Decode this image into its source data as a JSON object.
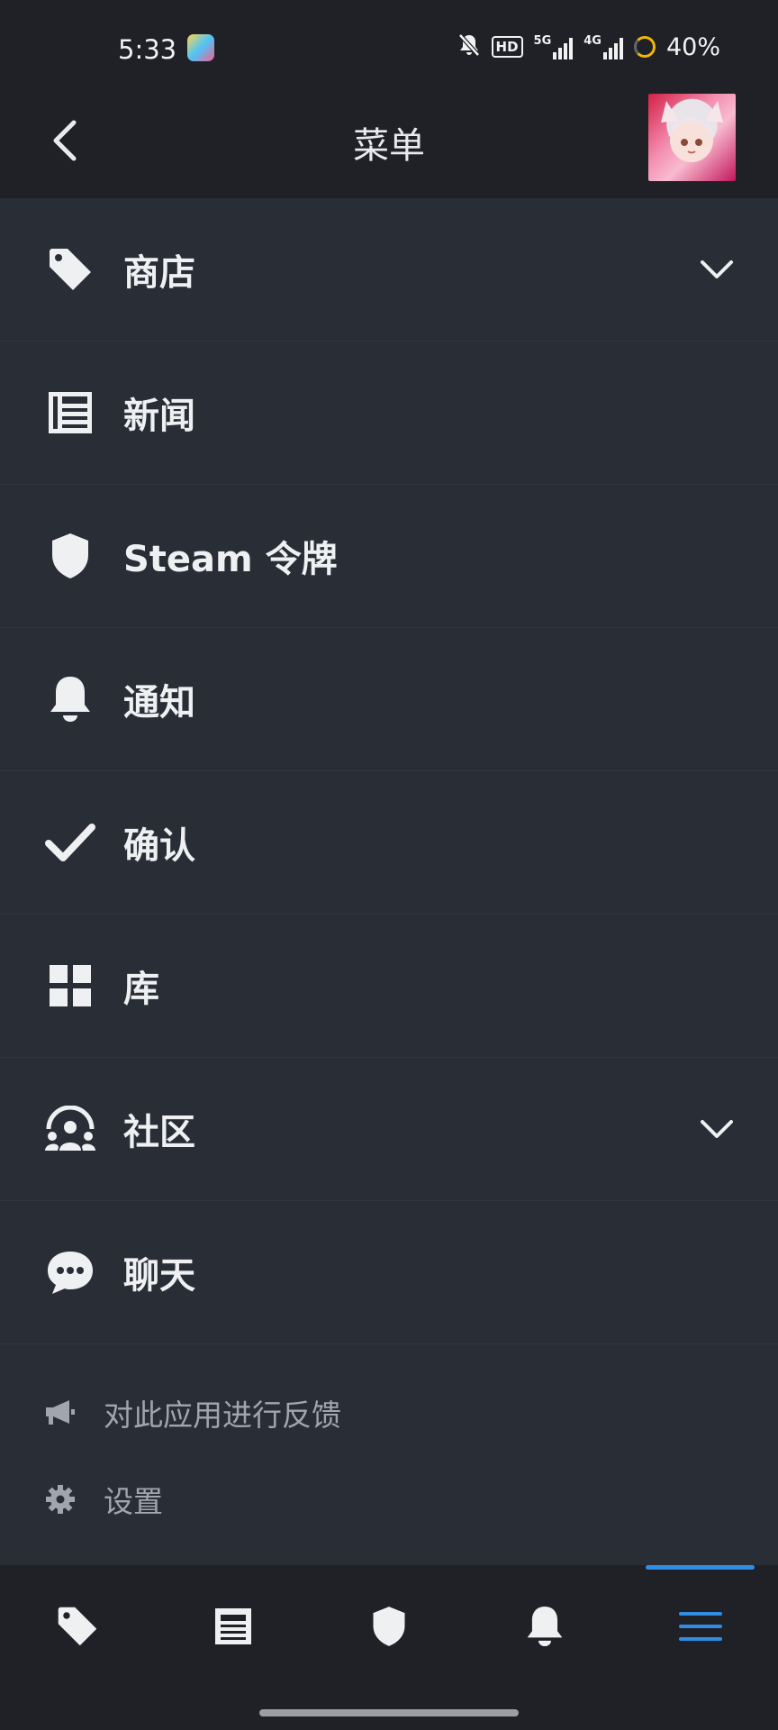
{
  "status_bar": {
    "time": "5:33",
    "hd_label": "HD",
    "sim1_label": "5G",
    "sim2_label": "4G",
    "battery": "40%"
  },
  "header": {
    "title": "菜单"
  },
  "menu": {
    "items": [
      {
        "label": "商店",
        "icon": "tag-icon",
        "expandable": true
      },
      {
        "label": "新闻",
        "icon": "news-icon",
        "expandable": false
      },
      {
        "label": "Steam 令牌",
        "icon": "shield-icon",
        "expandable": false
      },
      {
        "label": "通知",
        "icon": "bell-icon",
        "expandable": false
      },
      {
        "label": "确认",
        "icon": "checkmark-icon",
        "expandable": false
      },
      {
        "label": "库",
        "icon": "grid-icon",
        "expandable": false
      },
      {
        "label": "社区",
        "icon": "community-icon",
        "expandable": true
      },
      {
        "label": "聊天",
        "icon": "chat-icon",
        "expandable": false
      }
    ]
  },
  "secondary": {
    "feedback_label": "对此应用进行反馈",
    "settings_label": "设置"
  },
  "bottom_nav": {
    "items": [
      "tag-icon",
      "news-icon",
      "shield-icon",
      "bell-icon",
      "menu-icon"
    ],
    "active": "menu-icon"
  },
  "colors": {
    "background": "#292d36",
    "header": "#1f2127",
    "accent": "#2f8de4",
    "text": "#eef0f2",
    "secondary_text": "#a1a5ad"
  }
}
